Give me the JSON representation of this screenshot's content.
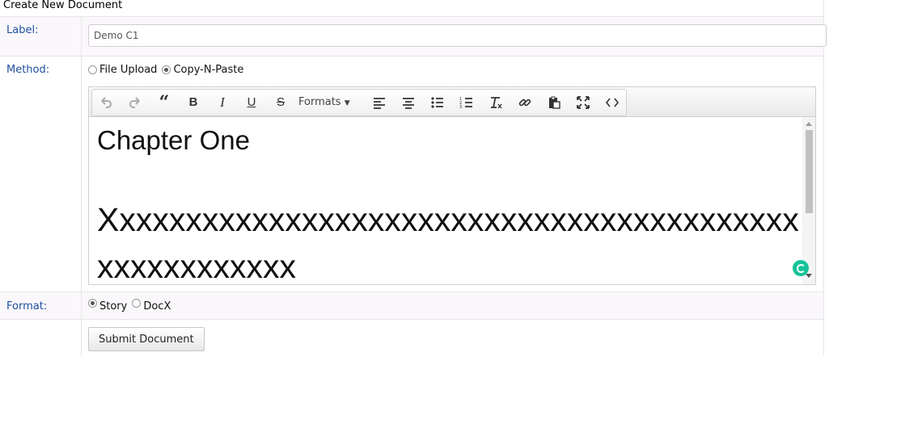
{
  "page": {
    "title": "Create New Document"
  },
  "label_row": {
    "label": "Label:",
    "value": "Demo C1"
  },
  "method_row": {
    "label": "Method:",
    "options": [
      {
        "label": "File Upload",
        "checked": false
      },
      {
        "label": "Copy-N-Paste",
        "checked": true
      }
    ]
  },
  "editor": {
    "toolbar": {
      "items": [
        "undo-icon",
        "redo-icon",
        "blockquote-icon",
        "bold-icon",
        "italic-icon",
        "underline-icon",
        "strikethrough-icon",
        "align-left-icon",
        "align-center-icon",
        "bullet-list-icon",
        "numbered-list-icon",
        "clear-formatting-icon",
        "link-icon",
        "paste-icon",
        "fullscreen-icon",
        "source-code-icon"
      ],
      "formats_label": "Formats"
    },
    "content": {
      "heading": "Chapter One",
      "paragraph": "Xxxxxxxxxxxxxxxxxxxxxxxxxxxxxxxxxxxxxxxxxxxxxxxxxxxxxx"
    }
  },
  "format_row": {
    "label": "Format:",
    "options": [
      {
        "label": "Story",
        "checked": true
      },
      {
        "label": "DocX",
        "checked": false
      }
    ]
  },
  "submit": {
    "label": "Submit Document"
  }
}
